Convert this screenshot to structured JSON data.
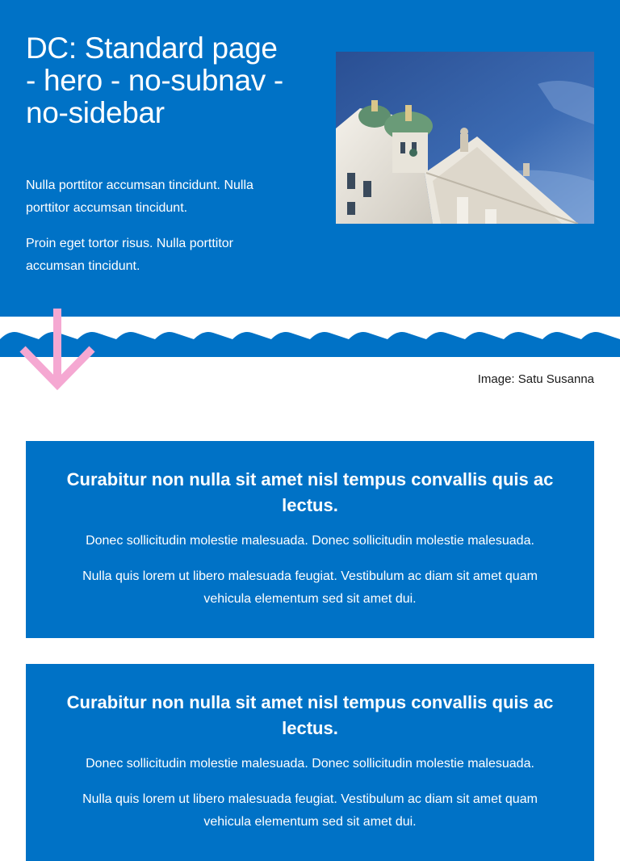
{
  "hero": {
    "title": "DC: Standard page - hero - no-subnav - no-sidebar",
    "paragraphs": [
      "Nulla porttitor accumsan tincidunt. Nulla porttitor accumsan tincidunt.",
      "Proin eget tortor risus. Nulla porttitor accumsan tincidunt."
    ],
    "image_caption": "Image: Satu Susanna"
  },
  "cards": [
    {
      "title": "Curabitur non nulla sit amet nisl tempus convallis quis ac lectus.",
      "paragraphs": [
        "Donec sollicitudin molestie malesuada. Donec sollicitudin molestie malesuada.",
        "Nulla quis lorem ut libero malesuada feugiat. Vestibulum ac diam sit amet quam vehicula elementum sed sit amet dui."
      ]
    },
    {
      "title": "Curabitur non nulla sit amet nisl tempus convallis quis ac lectus.",
      "paragraphs": [
        "Donec sollicitudin molestie malesuada. Donec sollicitudin molestie malesuada.",
        "Nulla quis lorem ut libero malesuada feugiat. Vestibulum ac diam sit amet quam vehicula elementum sed sit amet dui."
      ]
    }
  ],
  "colors": {
    "brand_blue": "#0072c6",
    "arrow_pink": "#f5a8d2",
    "white": "#ffffff"
  },
  "icons": {
    "scroll_arrow": "arrow-down-icon"
  }
}
